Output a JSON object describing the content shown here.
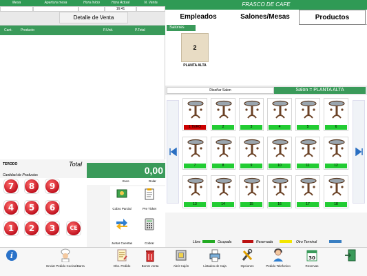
{
  "header": {
    "cols": [
      "Mesa",
      "Apertura mesa",
      "Hora Inicio",
      "Hora Actual",
      "N. Venta"
    ],
    "values": [
      "",
      "",
      "",
      "16:41",
      ""
    ],
    "detalle_title": "Detalle de Venta",
    "app_title": "FRASCO DE CAFE"
  },
  "tabs": [
    "Empleados",
    "Salones/Mesas",
    "Productos"
  ],
  "order_table": {
    "columns": [
      "Cant.",
      "Producto",
      "P.Unit.",
      "P.Total"
    ]
  },
  "salones": {
    "label": "Salones",
    "tile_number": "2",
    "tile_name": "PLANTA ALTA",
    "disenar": "Diseñar Salon",
    "current": "Salon = PLANTA ALTA"
  },
  "tables": [
    {
      "label": "1 TERO",
      "status": "reservada"
    },
    {
      "label": "2",
      "status": "libre"
    },
    {
      "label": "3",
      "status": "libre"
    },
    {
      "label": "4",
      "status": "libre"
    },
    {
      "label": "5",
      "status": "libre"
    },
    {
      "label": "6",
      "status": "libre"
    },
    {
      "label": "7",
      "status": "libre"
    },
    {
      "label": "8",
      "status": "libre"
    },
    {
      "label": "9",
      "status": "libre"
    },
    {
      "label": "10",
      "status": "libre"
    },
    {
      "label": "11",
      "status": "libre"
    },
    {
      "label": "12",
      "status": "libre"
    },
    {
      "label": "13",
      "status": "libre"
    },
    {
      "label": "14",
      "status": "libre"
    },
    {
      "label": "15",
      "status": "libre"
    },
    {
      "label": "16",
      "status": "libre"
    },
    {
      "label": "17",
      "status": "libre"
    },
    {
      "label": "18",
      "status": "libre"
    }
  ],
  "status_colors": {
    "libre": "#22cc33",
    "reservada": "#cc0000"
  },
  "legend": {
    "libre": "Libre",
    "ocupada": "Ocupada",
    "reservada": "Reservada",
    "otro": "Otro Terminal",
    "colors": {
      "libre": "#22cc33",
      "ocupada": "#22aa22",
      "reservada": "#bb1111",
      "otro": "#f3e600",
      "extra": "#3a7fc2"
    }
  },
  "totals": {
    "client": "TERODO",
    "total_label": "Total",
    "total_value": "0,00",
    "euro": "Euro",
    "dolar": "Dolar",
    "cantidad_label": "Cantidad de Productos"
  },
  "keypad": [
    "7",
    "8",
    "9",
    "4",
    "5",
    "6",
    "1",
    "2",
    "3",
    "CE"
  ],
  "side_actions": [
    {
      "label": "Cobro Parcial",
      "icon": "partial-payment-icon"
    },
    {
      "label": "Pre Ticket",
      "icon": "pre-ticket-icon"
    },
    {
      "label": "Juntar Cuentas",
      "icon": "merge-accounts-icon"
    },
    {
      "label": "Cobrar",
      "icon": "calculator-icon"
    }
  ],
  "bottom_buttons": [
    {
      "label": "",
      "icon": "info-icon"
    },
    {
      "label": "Enviar Pedido Cocina/Barra",
      "icon": "chef-icon"
    },
    {
      "label": "Obs. Pedido",
      "icon": "note-icon"
    },
    {
      "label": "Borrar venta",
      "icon": "trash-icon"
    },
    {
      "label": "Abrir Cajón",
      "icon": "cash-drawer-icon"
    },
    {
      "label": "Listados de Caja",
      "icon": "printer-icon"
    },
    {
      "label": "Opciones",
      "icon": "tools-icon"
    },
    {
      "label": "Pedido Telefonico",
      "icon": "phone-user-icon"
    },
    {
      "label": "Reservas",
      "icon": "calendar-icon"
    },
    {
      "label": "",
      "icon": "exit-door-icon"
    }
  ],
  "calendar_day": "30"
}
